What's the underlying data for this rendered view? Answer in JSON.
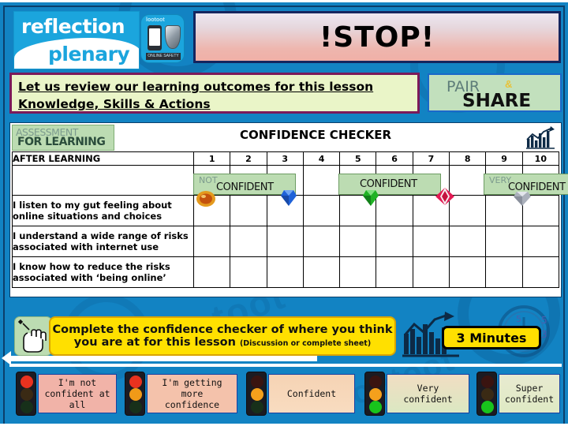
{
  "logo": {
    "line1": "reflection",
    "line2": "plenary",
    "app_brand": "lootoot",
    "app_tag": "ONLINE SAFETY"
  },
  "stop_banner": {
    "text": "!STOP!"
  },
  "outcomes": {
    "line1": "Let us review our learning outcomes for this lesson",
    "line2": "Knowledge, Skills & Actions"
  },
  "pair_share": {
    "pair": "PAIR",
    "amp": "&",
    "share": "SHARE"
  },
  "assessment_badge": {
    "line1": "ASSESSMENT",
    "line2": "FOR LEARNING"
  },
  "panel": {
    "title": "CONFIDENCE CHECKER",
    "chart_icon": "bar-chart-icon",
    "header_label": "AFTER LEARNING",
    "scale": [
      "1",
      "2",
      "3",
      "4",
      "5",
      "6",
      "7",
      "8",
      "9",
      "10"
    ],
    "band_labels": [
      {
        "small": "NOT",
        "big": "CONFIDENT"
      },
      {
        "small": "",
        "big": "CONFIDENT"
      },
      {
        "small": "VERY",
        "big": "CONFIDENT"
      }
    ],
    "gems": [
      "orange-gem-icon",
      "blue-gem-icon",
      "green-gem-icon",
      "red-gem-icon",
      "silver-gem-icon"
    ],
    "statements": [
      "I listen to my gut feeling about online situations and choices",
      "I understand a wide range of risks associated with internet use",
      "I know how to reduce the risks associated with ‘being online’"
    ]
  },
  "task": {
    "icon": "hand-with-pencil-icon",
    "line1": "Complete the confidence checker of where you think",
    "line2": "you are at for this lesson ",
    "line2_small": "(Discussion or complete sheet)",
    "timer_icon": "bar-chart-arrow-icon",
    "timer_label": "3 Minutes",
    "clock_icon": "clock-icon"
  },
  "traffic_lights": [
    {
      "label": "I'm not\nconfident at all",
      "lit": "red"
    },
    {
      "label": "I'm getting\nmore\nconfidence",
      "lit": "red-amber"
    },
    {
      "label": "Confident",
      "lit": "amber"
    },
    {
      "label": "Very\nconfident",
      "lit": "amber-green"
    },
    {
      "label": "Super\nconfident",
      "lit": "green"
    }
  ],
  "colors": {
    "slide_blue": "#1283c3",
    "banner_purple": "#7b1a5a",
    "outcome_green": "#eaf5c8",
    "label_green": "#bcdcb2",
    "yellow": "#ffe000",
    "navy": "#14255e"
  }
}
